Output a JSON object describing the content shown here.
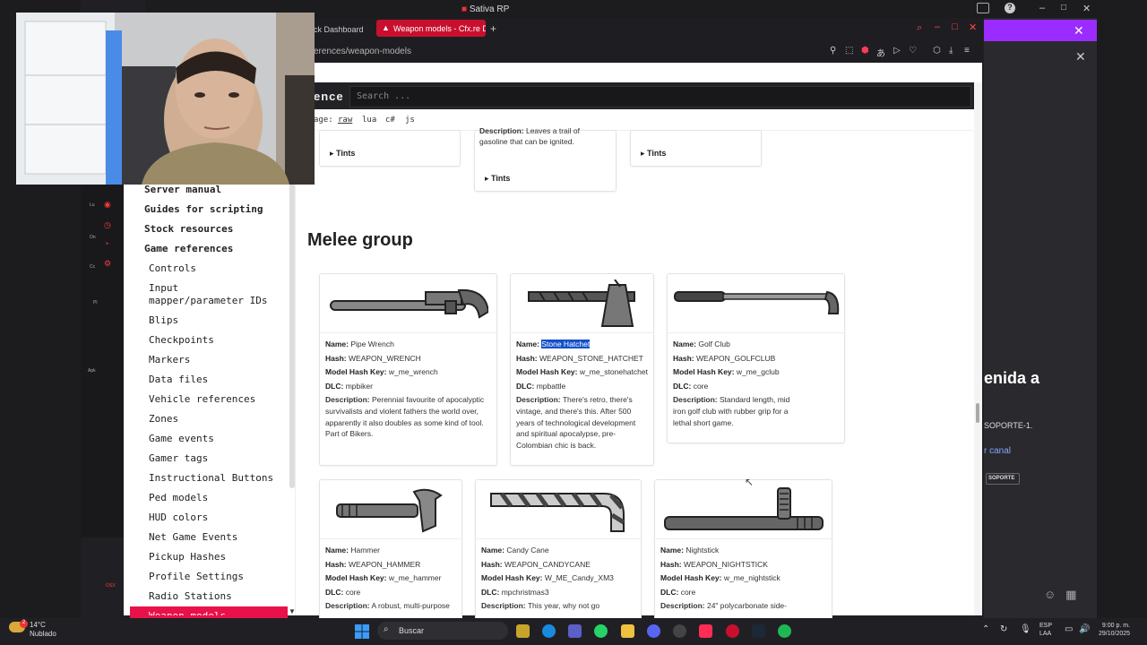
{
  "app": {
    "title": "Sativa RP"
  },
  "browser": {
    "tabs": [
      {
        "label": "ick Dashboard"
      },
      {
        "label": "Weapon models - Cfx.re D"
      }
    ],
    "address": "erences/weapon-models"
  },
  "site": {
    "brand": "ence",
    "search_placeholder": "Search ...",
    "lang_label": "age:",
    "langs": [
      "raw",
      "lua",
      "c#",
      "js"
    ]
  },
  "sidebar": {
    "top_items": [
      "Server manual",
      "Guides for scripting",
      "Stock resources",
      "Game references"
    ],
    "sub_items": [
      "Controls",
      "Input\nmapper/parameter IDs",
      "Blips",
      "Checkpoints",
      "Markers",
      "Data files",
      "Vehicle references",
      "Zones",
      "Game events",
      "Gamer tags",
      "Instructional Buttons",
      "Ped models",
      "HUD colors",
      "Net Game Events",
      "Pickup Hashes",
      "Profile Settings",
      "Radio Stations",
      "Weapon models"
    ]
  },
  "top_cards": {
    "tints_label": "Tints",
    "description_label": "Description:",
    "description_text": "Leaves a trail of gasoline that can be ignited."
  },
  "section_title": "Melee group",
  "labels": {
    "name": "Name:",
    "hash": "Hash:",
    "model_hash_key": "Model Hash Key:",
    "dlc": "DLC:",
    "description": "Description:"
  },
  "weapons": [
    {
      "name": "Pipe Wrench",
      "hash": "WEAPON_WRENCH",
      "model": "w_me_wrench",
      "dlc": "mpbiker",
      "description": "Perennial favourite of apocalyptic survivalists and violent fathers the world over, apparently it also doubles as some kind of tool. Part of Bikers."
    },
    {
      "name": "Stone Hatchet",
      "hash": "WEAPON_STONE_HATCHET",
      "model": "w_me_stonehatchet",
      "dlc": "mpbattle",
      "description": "There's retro, there's vintage, and there's this. After 500 years of technological development and spiritual apocalypse, pre-Colombian chic is back."
    },
    {
      "name": "Golf Club",
      "hash": "WEAPON_GOLFCLUB",
      "model": "w_me_gclub",
      "dlc": "core",
      "description": "Standard length, mid iron golf club with rubber grip for a lethal short game."
    },
    {
      "name": "Hammer",
      "hash": "WEAPON_HAMMER",
      "model": "w_me_hammer",
      "dlc": "core",
      "description": "A robust, multi-purpose"
    },
    {
      "name": "Candy Cane",
      "hash": "WEAPON_CANDYCANE",
      "model": "W_ME_Candy_XM3",
      "dlc": "mpchristmas3",
      "description": "This year, why not go"
    },
    {
      "name": "Nightstick",
      "hash": "WEAPON_NIGHTSTICK",
      "model": "w_me_nightstick",
      "dlc": "core",
      "description": "24\" polycarbonate side-"
    }
  ],
  "right_panel": {
    "heading": "enida a",
    "soporte": "SOPORTE-1.",
    "canal": "r canal",
    "button": "SOPORTE"
  },
  "left_strip": {
    "t1": "Lu",
    "t2": "On",
    "t3": "Cc",
    "t4": "Pl",
    "t5": "Apk",
    "t6": "OSX"
  },
  "taskbar": {
    "temp": "14°C",
    "weather": "Nublado",
    "search": "Buscar",
    "lang1": "ESP",
    "lang2": "LAA",
    "time": "9:00 p. m.",
    "date": "29/10/2025",
    "notif": "2"
  }
}
